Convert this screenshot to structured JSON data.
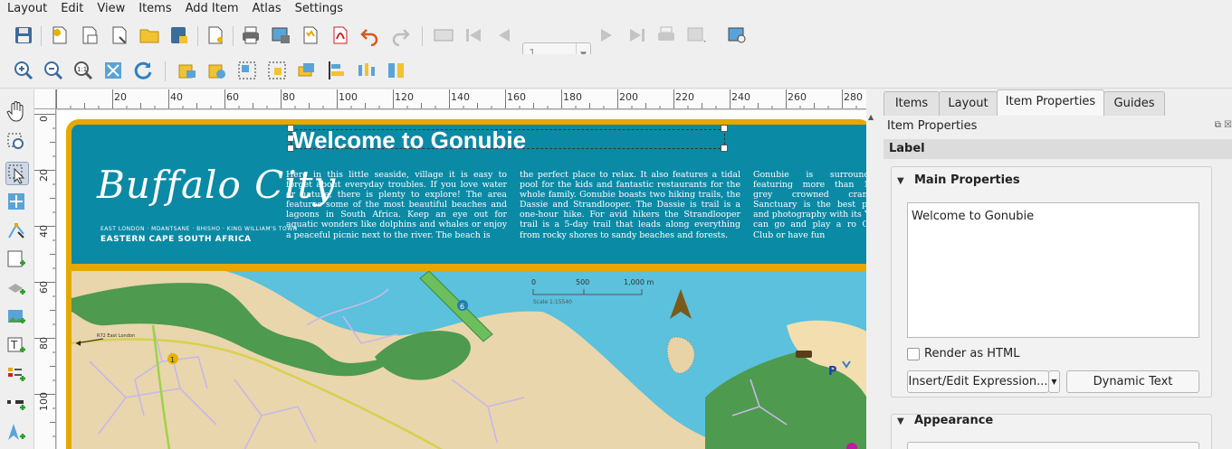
{
  "menubar": [
    "Layout",
    "Edit",
    "View",
    "Items",
    "Add Item",
    "Atlas",
    "Settings"
  ],
  "toolbar": {
    "page_value": "1"
  },
  "rulers": {
    "h_ticks": [
      "20",
      "40",
      "60",
      "80",
      "100",
      "120",
      "140",
      "160",
      "180",
      "200",
      "220",
      "240",
      "260",
      "280"
    ],
    "v_ticks": [
      "0",
      "20",
      "40",
      "60",
      "80",
      "100",
      "120"
    ]
  },
  "layout_page": {
    "logo_script": "Buffalo City",
    "logo_sub": "EAST LONDON · MDANTSANE · BHISHO · KING WILLIAM'S TOWN",
    "logo_region": "EASTERN CAPE   SOUTH AFRICA",
    "title": "Welcome to Gonubie",
    "col1": "Here in this little seaside, village it is easy to forget about everyday troubles. If you love water or nature, there is plenty to explore! The area features some of the most beautiful beaches and lagoons in South Africa. Keep an eye out for aquatic wonders like dolphins and whales or enjoy a peaceful picnic next to the river. The beach is",
    "col2": "the perfect place to relax. It also features a tidal pool for the kids and fantastic restaurants for the whole family. Gonubie boasts two hiking trails, the Dassie and Strandlooper. The Dassie is trail is a one-hour hike. For avid hikers the Strandlooper trail is a 5-day trail that leads along everything from rocky shores to sandy beaches and forests.",
    "col3": "Gonubie is surrounded featuring more than 160 grey crowned cranes. Sanctuary is the best plac and photography with its You can go and play a ro Golf Club or have fun",
    "scale_labels": [
      "0",
      "500",
      "1,000 m"
    ],
    "scale_text": "Scale 1:15540",
    "road_label": "R72 East London",
    "marker_1": "1",
    "marker_6": "6",
    "parking": "P"
  },
  "panel": {
    "tabs": [
      "Items",
      "Layout",
      "Item Properties",
      "Guides"
    ],
    "title": "Item Properties",
    "section": "Label",
    "main_properties": "Main Properties",
    "label_text": "Welcome to Gonubie",
    "render_html": "Render as HTML",
    "insert_expression": "Insert/Edit Expression...",
    "dynamic_text": "Dynamic Text",
    "appearance": "Appearance"
  },
  "colors": {
    "header_blue": "#0b8aa5",
    "frame_gold": "#e5a800",
    "map_land": "#e9d6ad",
    "water": "#5bc1dc",
    "park_green": "#4e9a4e"
  }
}
